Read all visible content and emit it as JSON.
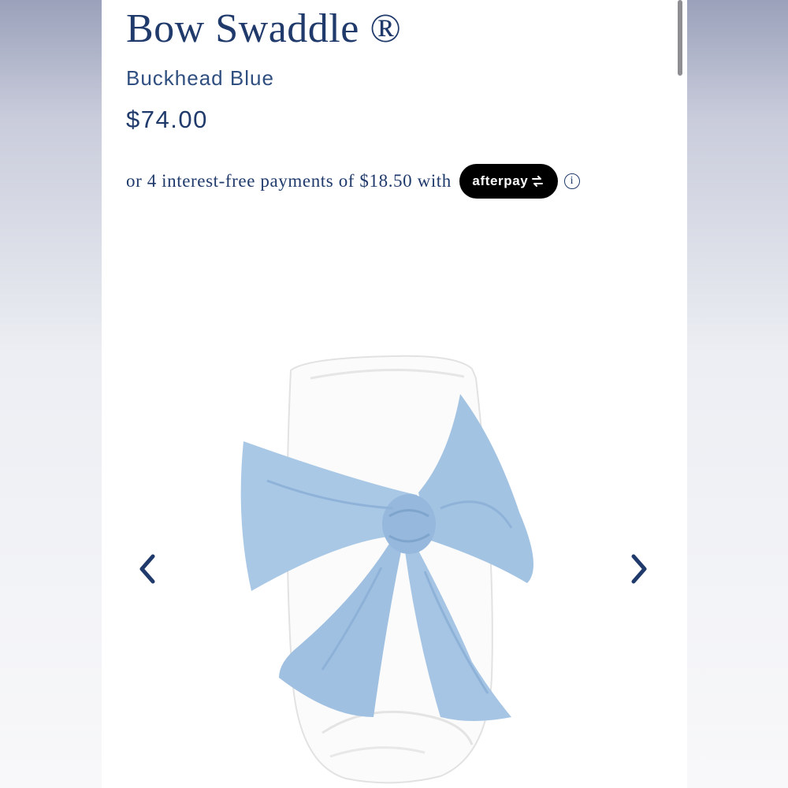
{
  "product": {
    "title": "Bow Swaddle ®",
    "color_name": "Buckhead Blue",
    "price": "$74.00"
  },
  "payment": {
    "installment_text": "or 4 interest-free payments of $18.50 with",
    "provider_label": "afterpay",
    "provider_icon": "afterpay-arrows-icon",
    "info_icon": "info-icon",
    "info_glyph": "i"
  },
  "gallery": {
    "prev_icon": "chevron-left-icon",
    "next_icon": "chevron-right-icon",
    "image_subject": "white swaddle blanket tied with light blue bow"
  },
  "colors": {
    "text_primary": "#1f3a6b",
    "bow_blue": "#a9c8e6",
    "badge_black": "#000000"
  }
}
